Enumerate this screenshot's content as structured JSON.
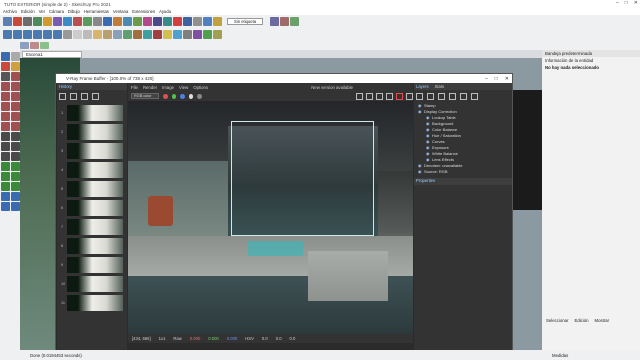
{
  "window": {
    "title": "TUTO EXTERIOR (simple de 2) - SketchUp Pro 2021"
  },
  "menu": [
    "Archivo",
    "Edición",
    "Ver",
    "Cámara",
    "Dibujo",
    "Herramientas",
    "Ventana",
    "Extensiones",
    "Ayuda"
  ],
  "toolbar": {
    "tag_select": "Sin etiqueta"
  },
  "scene_tab": "Escena1",
  "vfb": {
    "title": "V-Ray Frame Buffer - [100.0% of 738 x 420]",
    "panel_history": "History",
    "menu": [
      "File",
      "Render",
      "Image",
      "View",
      "Options"
    ],
    "version_note": "New version available",
    "channel": "RGB color",
    "panel_layers": "Layers",
    "panel_stats": "Stats",
    "layers": [
      "Stamp",
      "Display Correction",
      "Lookup Table",
      "Background",
      "Color Balance",
      "Hue / Saturation",
      "Curves",
      "Exposure",
      "White Balance",
      "Lens Effects",
      "Denoiser: unavailable",
      "Source: RGB"
    ],
    "properties": "Properties",
    "status": {
      "coords": "[434, 666]",
      "bits": "1x1",
      "mode": "Raw",
      "r": "0.000",
      "g": "0.000",
      "b": "0.000",
      "fmt": "HSV",
      "h": "0.0",
      "s": "0.0",
      "v": "0.0"
    },
    "history_thumbs": [
      "1",
      "2",
      "3",
      "4",
      "5",
      "6",
      "7",
      "8",
      "9",
      "10",
      "11",
      "12",
      "13"
    ]
  },
  "right_panel": {
    "tray": "Bandeja predeterminada",
    "entity_info": "Información de la entidad",
    "no_selection": "No hay nada seleccionado",
    "select_tab": "Seleccionar",
    "edit_tab": "Edición",
    "mostrar": "Mostrar"
  },
  "status_bar": {
    "done": "Done (0.0194453 seconds)",
    "medidas": "Medidas"
  }
}
